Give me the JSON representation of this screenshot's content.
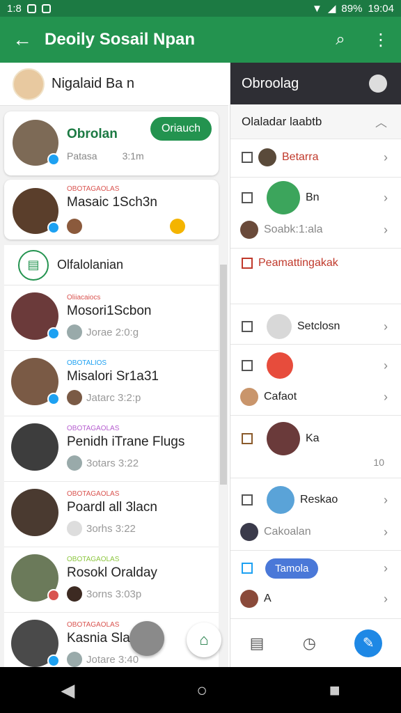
{
  "status": {
    "time_left": "1:8",
    "battery": "89%",
    "time_right": "19:04"
  },
  "appbar": {
    "title": "Deoily Sosail Npan"
  },
  "profile": {
    "name": "Nigalaid Ba n"
  },
  "cards": [
    {
      "name": "Obrolan",
      "sub": "Patasa",
      "time": "3:1m",
      "action": "Oriauch"
    },
    {
      "tag": "OBOTAGAOLAS",
      "name": "Masaic 1Sch3n"
    }
  ],
  "section": {
    "label": "Olfalolanian"
  },
  "list": [
    {
      "tag": "Oliiacaiocs",
      "name": "Mosori1Scbon",
      "sub": "Jorae 2:0:g",
      "tagcolor": "#d9534f"
    },
    {
      "tag": "OBOTALIOS",
      "name": "Misalori Sr1a31",
      "sub": "Jatarc 3:2:p",
      "tagcolor": "#1da1f2"
    },
    {
      "tag": "OBOTAGAOLAS",
      "name": "Penidh iTrane Flugs",
      "sub": "3otars 3:22",
      "tagcolor": "#b55dcf"
    },
    {
      "tag": "OBOTAGAOLAS",
      "name": "Poardl all 3lacn",
      "sub": "3orhs 3:22",
      "tagcolor": "#d9534f"
    },
    {
      "tag": "OBOTAGAOLAS",
      "name": "Rosokl Oralday",
      "sub": "3orns 3:03p",
      "tagcolor": "#8cc63f"
    },
    {
      "tag": "OBOTAGAOLAS",
      "name": "Kasnia Sla",
      "sub": "Jotare 3:40",
      "tagcolor": "#d9534f"
    }
  ],
  "right": {
    "header": "Obroolag",
    "sub": "Olaladar laabtb",
    "items": [
      {
        "label": "Betarra"
      },
      {
        "label": "Bn"
      },
      {
        "label": "Soabk:1:ala"
      },
      {
        "label": "Peamattingakak"
      },
      {
        "label": "Setclosn"
      },
      {
        "label": "Cafaot"
      },
      {
        "label": "Ka"
      },
      {
        "label": "Reskao"
      },
      {
        "label": "Cakoalan"
      },
      {
        "label": "Tamola"
      },
      {
        "label": "A"
      }
    ],
    "count": "10"
  }
}
